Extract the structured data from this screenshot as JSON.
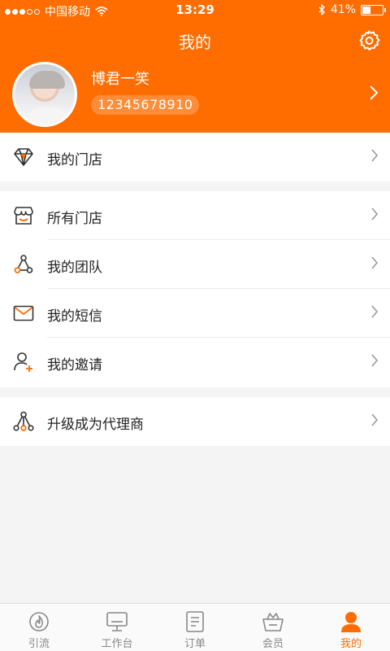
{
  "status_bar": {
    "carrier": "中国移动",
    "time": "13:29",
    "battery_text": "41%",
    "battery_level": 0.41
  },
  "header": {
    "title": "我的",
    "settings_icon": "gear-icon"
  },
  "profile": {
    "name": "博君一笑",
    "phone": "12345678910"
  },
  "menu_groups": [
    [
      {
        "label": "我的门店",
        "icon": "diamond-icon"
      }
    ],
    [
      {
        "label": "所有门店",
        "icon": "store-icon"
      },
      {
        "label": "我的团队",
        "icon": "team-icon"
      },
      {
        "label": "我的短信",
        "icon": "mail-icon"
      },
      {
        "label": "我的邀请",
        "icon": "invite-user-icon"
      }
    ],
    [
      {
        "label": "升级成为代理商",
        "icon": "hierarchy-icon"
      }
    ]
  ],
  "tabbar": {
    "items": [
      {
        "label": "引流",
        "icon": "flame-icon",
        "active": false
      },
      {
        "label": "工作台",
        "icon": "monitor-icon",
        "active": false
      },
      {
        "label": "订单",
        "icon": "document-icon",
        "active": false
      },
      {
        "label": "会员",
        "icon": "crown-basket-icon",
        "active": false
      },
      {
        "label": "我的",
        "icon": "person-icon",
        "active": true
      }
    ]
  },
  "colors": {
    "accent": "#ff6c00",
    "icon_dark": "#333333",
    "chevron": "#9a9a9a"
  }
}
